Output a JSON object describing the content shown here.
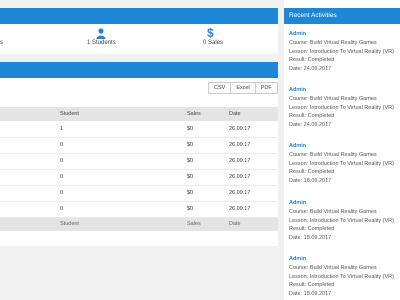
{
  "stats": {
    "left_partial": "s",
    "students": "1 Students",
    "sales": "0 Sales"
  },
  "export_buttons": [
    "CSV",
    "Excel",
    "PDF"
  ],
  "table": {
    "headers": [
      "",
      "Student",
      "Sales",
      "Date"
    ],
    "rows": [
      [
        "",
        "1",
        "$0",
        "26.09.17"
      ],
      [
        "",
        "0",
        "$0",
        "26.09.17"
      ],
      [
        "",
        "0",
        "$0",
        "26.09.17"
      ],
      [
        "",
        "0",
        "$0",
        "26.09.17"
      ],
      [
        "",
        "0",
        "$0",
        "26.09.17"
      ],
      [
        "",
        "0",
        "$0",
        "26.09.17"
      ]
    ],
    "footer": [
      "",
      "Student",
      "Sales",
      "Date"
    ]
  },
  "recent": {
    "title": "Recent Activities",
    "items": [
      {
        "user": "Admin",
        "course": "Course: Build Virtual Reality Games",
        "lesson": "Lesson: Introduction To Virtual Reality (VR)",
        "result": "Result: Completed",
        "date": "Date: 24.09.2017"
      },
      {
        "user": "Admin",
        "course": "Course: Build Virtual Reality Games",
        "lesson": "Lesson: Introduction To Virtual Reality (VR)",
        "result": "Result: Completed",
        "date": "Date: 24.09.2017"
      },
      {
        "user": "Admin",
        "course": "Course: Build Virtual Reality Games",
        "lesson": "Lesson: Introduction To Virtual Reality (VR)",
        "result": "Result: Completed",
        "date": "Date: 18.09.2017"
      },
      {
        "user": "Admin",
        "course": "Course: Build Virtual Reality Games",
        "lesson": "Lesson: Introduction To Virtual Reality (VR)",
        "result": "Result: Completed",
        "date": "Date: 18.09.2017"
      },
      {
        "user": "Admin",
        "course": "Course: Build Virtual Reality Games",
        "lesson": "Lesson: Introduction To Virtual Reality (VR)",
        "result": "Result: Completed",
        "date": "Date: 18.09.2017"
      }
    ]
  },
  "colors": {
    "accent": "#1e88d6",
    "header_row": "#e4e4e4",
    "background": "#f1f1f1"
  }
}
